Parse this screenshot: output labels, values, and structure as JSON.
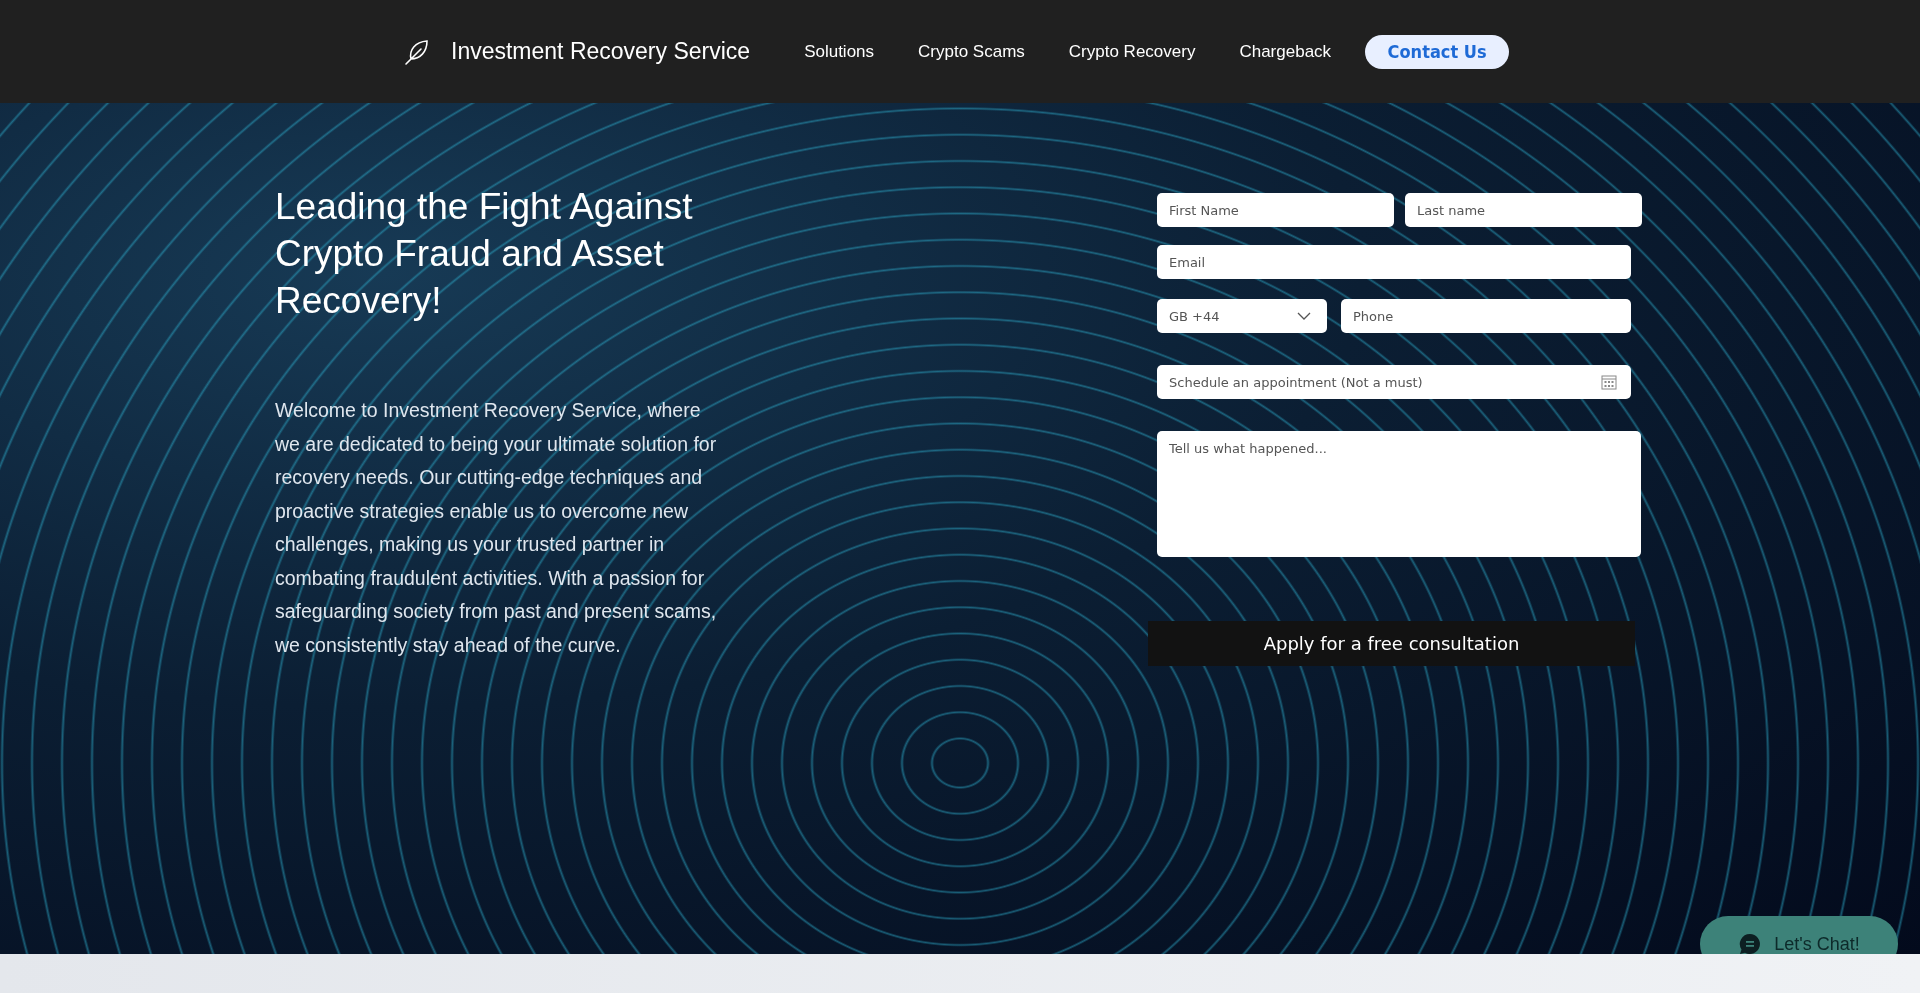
{
  "header": {
    "brand": "Investment Recovery Service",
    "nav": [
      {
        "label": "Solutions"
      },
      {
        "label": "Crypto Scams"
      },
      {
        "label": "Crypto Recovery"
      },
      {
        "label": "Chargeback"
      }
    ],
    "cta": "Contact Us"
  },
  "hero": {
    "heading": "Leading the Fight Against Crypto Fraud and Asset Recovery!",
    "body": "Welcome to Investment Recovery Service, where we are dedicated to being your ultimate solution for recovery needs. Our cutting-edge techniques and proactive strategies enable us to overcome new challenges, making us your trusted partner in combating fraudulent activities. With a passion for safeguarding society from past and present scams, we consistently stay ahead of the curve."
  },
  "form": {
    "first_name": {
      "placeholder": "First Name"
    },
    "last_name": {
      "placeholder": "Last name"
    },
    "email": {
      "placeholder": "Email"
    },
    "country_code": {
      "value": "GB +44"
    },
    "phone": {
      "placeholder": "Phone"
    },
    "schedule": {
      "placeholder": "Schedule an appointment (Not a must)"
    },
    "message": {
      "placeholder": "Tell us what happened..."
    },
    "submit": "Apply for a free consultation"
  },
  "chat": {
    "label": "Let's Chat!"
  }
}
